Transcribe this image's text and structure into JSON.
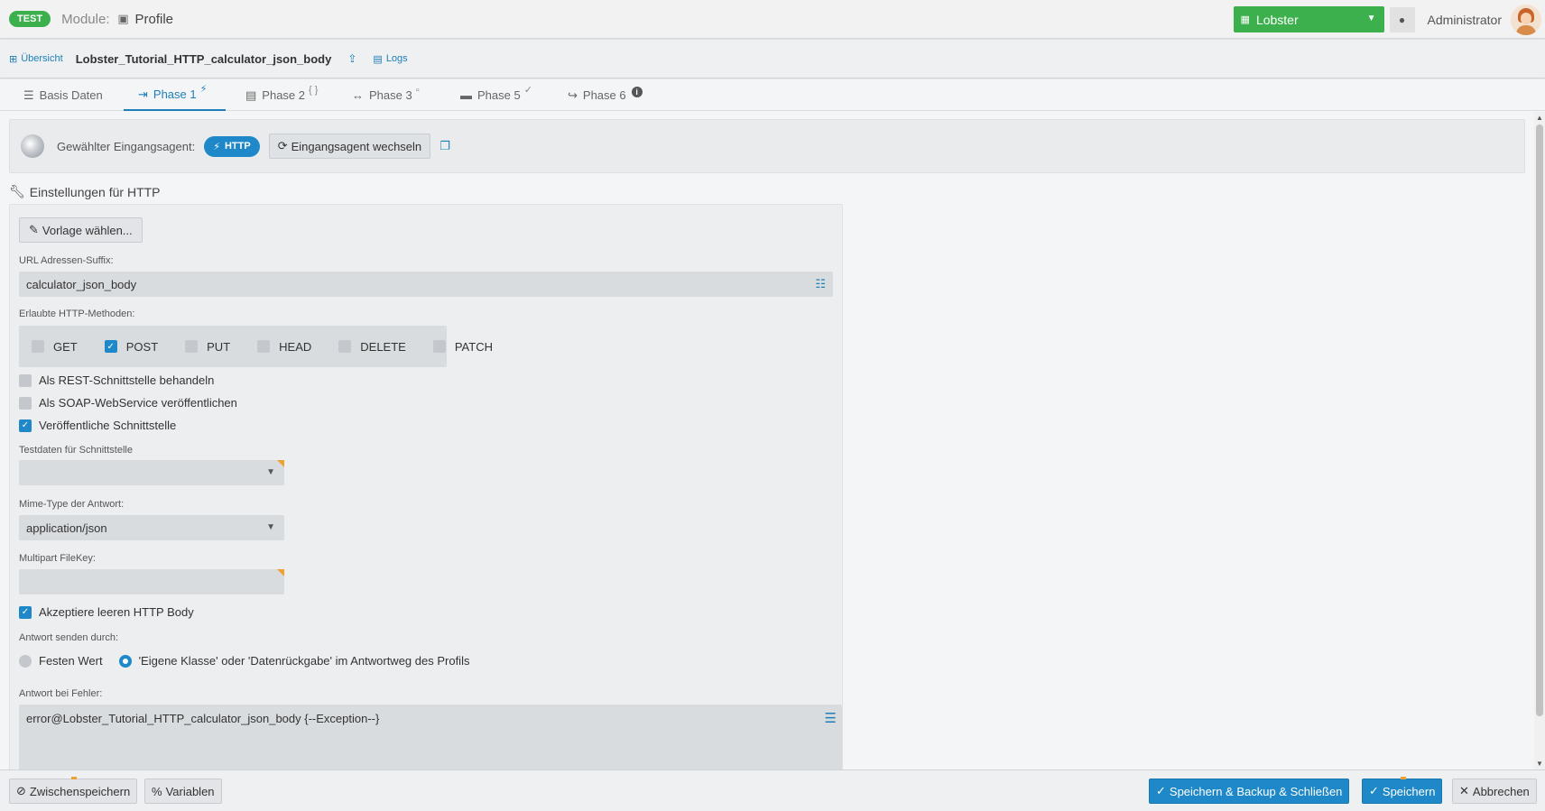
{
  "header": {
    "env_badge": "TEST",
    "module_label": "Module:",
    "module_name": "Profile",
    "instance": "Lobster",
    "user": "Administrator"
  },
  "breadcrumb": {
    "overview": "Übersicht",
    "profile_name": "Lobster_Tutorial_HTTP_calculator_json_body",
    "logs": "Logs"
  },
  "tabs": [
    {
      "label": "Basis Daten",
      "icon": "list-icon"
    },
    {
      "label": "Phase 1",
      "icon": "sign-in-icon",
      "badge": "⚡"
    },
    {
      "label": "Phase 2",
      "icon": "file-icon",
      "badge": "{ }"
    },
    {
      "label": "Phase 3",
      "icon": "arrows-h-icon",
      "badge": "▫"
    },
    {
      "label": "Phase 5",
      "icon": "server-icon",
      "badge": "✓"
    },
    {
      "label": "Phase 6",
      "icon": "share-icon",
      "badge": "i"
    }
  ],
  "agent": {
    "label": "Gewählter Eingangsagent:",
    "type": "HTTP",
    "switch_label": "Eingangsagent wechseln"
  },
  "settings": {
    "title": "Einstellungen für HTTP",
    "template_button": "Vorlage wählen...",
    "url_suffix_label": "URL Adressen-Suffix:",
    "url_suffix_value": "calculator_json_body",
    "methods_label": "Erlaubte HTTP-Methoden:",
    "methods": [
      {
        "name": "GET",
        "checked": false
      },
      {
        "name": "POST",
        "checked": true
      },
      {
        "name": "PUT",
        "checked": false
      },
      {
        "name": "HEAD",
        "checked": false
      },
      {
        "name": "DELETE",
        "checked": false
      },
      {
        "name": "PATCH",
        "checked": false
      }
    ],
    "rest_label": "Als REST-Schnittstelle behandeln",
    "soap_label": "Als SOAP-WebService veröffentlichen",
    "public_label": "Veröffentliche Schnittstelle",
    "testdata_label": "Testdaten für Schnittstelle",
    "testdata_value": "",
    "mime_label": "Mime-Type der Antwort:",
    "mime_value": "application/json",
    "multipart_label": "Multipart FileKey:",
    "multipart_value": "",
    "empty_body_label": "Akzeptiere leeren HTTP Body",
    "response_via_label": "Antwort senden durch:",
    "response_fixed": "Festen Wert",
    "response_class": "'Eigene Klasse' oder 'Datenrückgabe' im Antwortweg des Profils",
    "error_label": "Antwort bei Fehler:",
    "error_value": "error@Lobster_Tutorial_HTTP_calculator_json_body {--Exception--}"
  },
  "footer": {
    "interim_save": "Zwischenspeichern",
    "variables": "Variablen",
    "save_backup_close": "Speichern & Backup & Schließen",
    "save": "Speichern",
    "cancel": "Abbrechen"
  }
}
